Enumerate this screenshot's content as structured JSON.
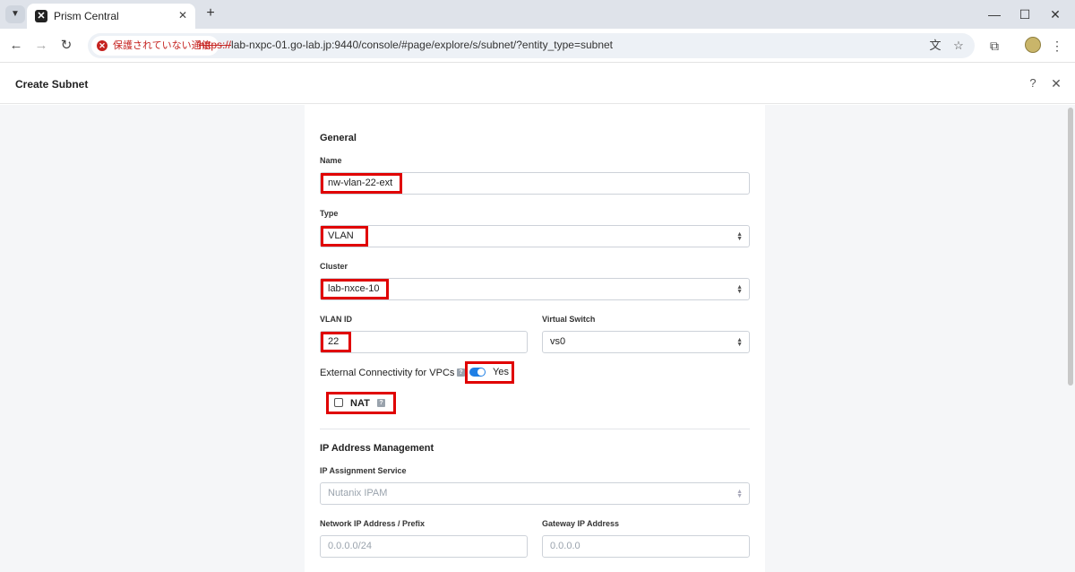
{
  "browser": {
    "tab_title": "Prism Central",
    "tab_favicon_glyph": "✕",
    "security_label": "保護されていない通信",
    "url_scheme": "https://",
    "url_rest": "lab-nxpc-01.go-lab.jp:9440/console/#page/explore/s/subnet/?entity_type=subnet"
  },
  "page": {
    "title": "Create Subnet"
  },
  "form": {
    "general_title": "General",
    "name_label": "Name",
    "name_value": "nw-vlan-22-ext",
    "type_label": "Type",
    "type_value": "VLAN",
    "cluster_label": "Cluster",
    "cluster_value": "lab-nxce-10",
    "vlan_id_label": "VLAN ID",
    "vlan_id_value": "22",
    "virtual_switch_label": "Virtual Switch",
    "virtual_switch_value": "vs0",
    "external_connectivity_label": "External Connectivity for VPCs",
    "external_connectivity_value": "Yes",
    "external_connectivity_on": true,
    "nat_label": "NAT",
    "nat_checked": false,
    "ipam_title": "IP Address Management",
    "ip_assignment_label": "IP Assignment Service",
    "ip_assignment_value": "Nutanix IPAM",
    "network_prefix_label": "Network IP Address / Prefix",
    "network_prefix_placeholder": "0.0.0.0/24",
    "gateway_label": "Gateway IP Address",
    "gateway_placeholder": "0.0.0.0"
  },
  "colors": {
    "highlight": "#e00000",
    "toggle_on": "#1f7fe5",
    "insecure_red": "#c5221f"
  },
  "icons": {
    "tab_menu": "chevron-down-icon",
    "back": "arrow-left-icon",
    "forward": "arrow-right-icon",
    "reload": "reload-icon",
    "translate": "translate-icon",
    "bookmark": "star-icon",
    "extensions": "puzzle-icon",
    "help": "question-icon",
    "close": "close-icon"
  }
}
